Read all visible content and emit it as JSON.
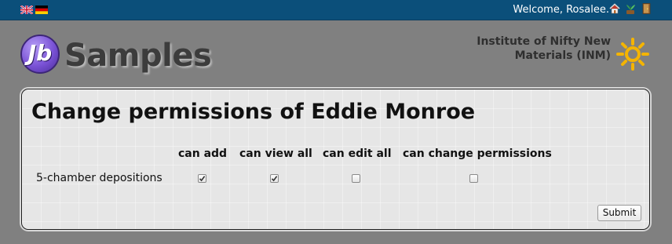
{
  "header": {
    "languages": [
      {
        "name": "English",
        "icon": "uk-flag-icon"
      },
      {
        "name": "Deutsch",
        "icon": "german-flag-icon"
      }
    ],
    "welcome_text": "Welcome, Rosalee.",
    "icons": [
      "home-icon",
      "plants-icon",
      "logout-door-icon"
    ],
    "bar_color": "#0b4f7a"
  },
  "branding": {
    "logo_mark": "Jb",
    "logo_text": "Samples",
    "institute_line1": "Institute of Nifty New",
    "institute_line2": "Materials (INM)",
    "institute_icon": "sun-icon"
  },
  "main": {
    "title": "Change permissions of Eddie Monroe",
    "columns": [
      "can add",
      "can view all",
      "can edit all",
      "can change permissions"
    ],
    "rows": [
      {
        "label": "5-chamber depositions",
        "permissions": [
          true,
          true,
          false,
          false
        ]
      }
    ],
    "submit_label": "Submit"
  }
}
